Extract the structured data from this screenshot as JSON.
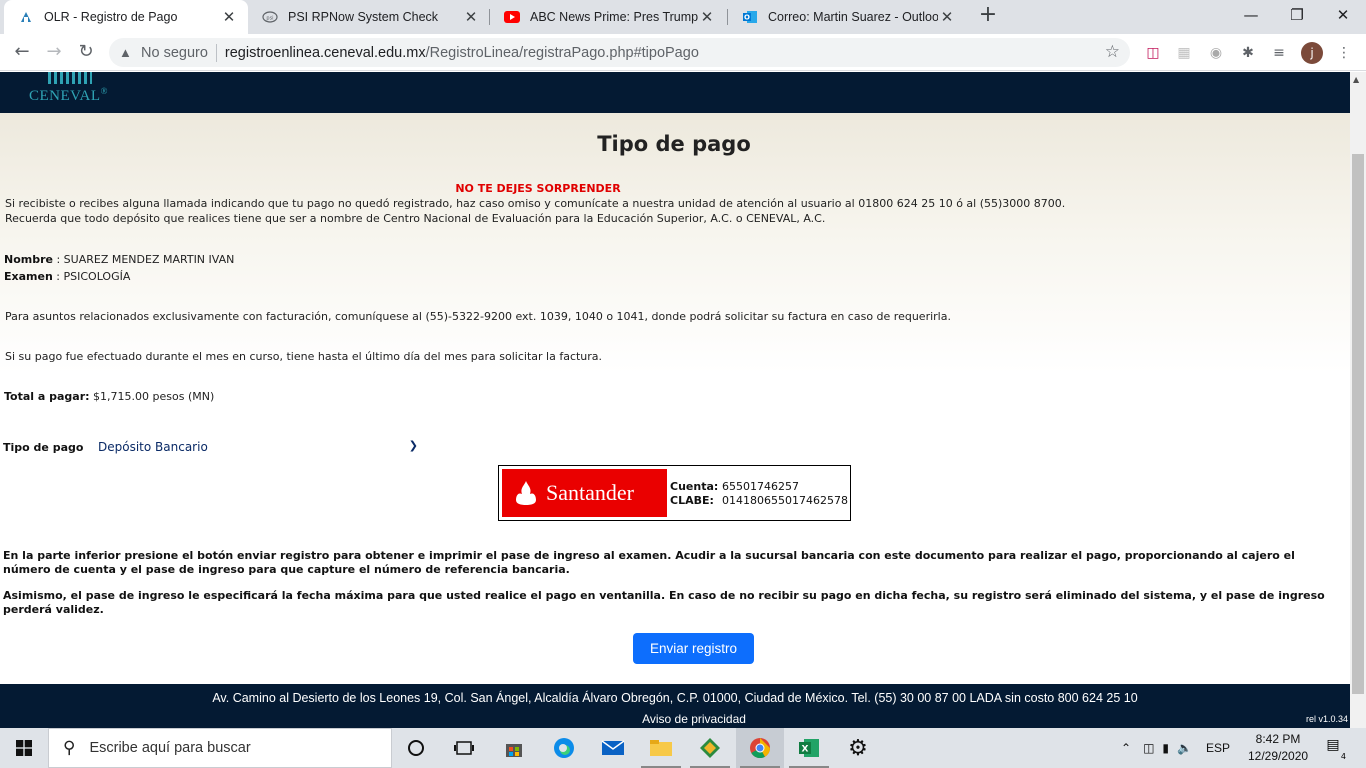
{
  "browser": {
    "tabs": [
      {
        "title": "OLR - Registro de Pago",
        "icon": "ceneval-favicon",
        "active": true
      },
      {
        "title": "PSI RPNow System Check",
        "icon": "psi-favicon",
        "active": false
      },
      {
        "title": "ABC News Prime: Pres Trump's fi",
        "icon": "youtube-favicon",
        "active": false
      },
      {
        "title": "Correo: Martin Suarez - Outlook",
        "icon": "outlook-favicon",
        "active": false
      }
    ],
    "security_label": "No seguro",
    "url_host": "registroenlinea.ceneval.edu.mx",
    "url_path": "/RegistroLinea/registraPago.php#tipoPago",
    "profile_initial": "j"
  },
  "header": {
    "logo_text": "CENEVAL",
    "logo_mark": "®"
  },
  "page": {
    "title": "Tipo de pago",
    "alert_title": "NO TE DEJES SORPRENDER",
    "alert_line1": "Si recibiste o recibes alguna llamada indicando que tu pago no quedó registrado, haz caso omiso y comunícate a nuestra unidad de atención al usuario al 01800 624 25 10 ó al (55)3000 8700.",
    "alert_line2": "Recuerda que todo depósito que realices tiene que ser a nombre de Centro Nacional de Evaluación para la Educación Superior, A.C. o CENEVAL, A.C.",
    "name_label": "Nombre",
    "name_value": " : SUAREZ MENDEZ MARTIN IVAN",
    "exam_label": "Examen",
    "exam_value": " : PSICOLOGÍA",
    "billing_text": "Para asuntos relacionados exclusivamente con facturación, comuníquese al (55)-5322-9200 ext. 1039, 1040 o 1041, donde podrá solicitar su factura en caso de requerirla.",
    "invoice_text": "Si su pago fue efectuado durante el mes en curso, tiene hasta el último día del mes para solicitar la factura.",
    "total_label": "Total a pagar:",
    "total_value": " $1,715.00 pesos (MN)",
    "payment_type_label": "Tipo de pago",
    "payment_type_value": "Depósito Bancario",
    "bank": {
      "name": "Santander",
      "account_label": "Cuenta:",
      "account_value": "65501746257",
      "clabe_label": "CLABE:",
      "clabe_value": "014180655017462578"
    },
    "instruction1": "En la parte inferior presione el botón enviar registro para obtener e imprimir el pase de ingreso al examen. Acudir a la sucursal bancaria con este documento para realizar el pago, proporcionando al cajero el número de cuenta y el pase de ingreso para que capture el número de referencia bancaria.",
    "instruction2": "Asimismo, el pase de ingreso le especificará la fecha máxima para que usted realice el pago en ventanilla. En caso de no recibir su pago en dicha fecha, su registro será eliminado del sistema, y el pase de ingreso perderá validez.",
    "submit_label": "Enviar registro"
  },
  "footer": {
    "address": "Av. Camino al Desierto de los Leones 19, Col. San Ángel, Alcaldía Álvaro Obregón, C.P. 01000, Ciudad de México. Tel. (55) 30 00 87 00 LADA sin costo 800 624 25 10",
    "privacy": "Aviso de privacidad",
    "version": "rel v1.0.34"
  },
  "taskbar": {
    "search_placeholder": "Escribe aquí para buscar",
    "language": "ESP",
    "time": "8:42 PM",
    "date": "12/29/2020",
    "notifications": "4"
  },
  "colors": {
    "accent_red": "#e00000",
    "header_navy": "#041a33",
    "button_blue": "#0d6efd",
    "santander_red": "#ea0000"
  }
}
